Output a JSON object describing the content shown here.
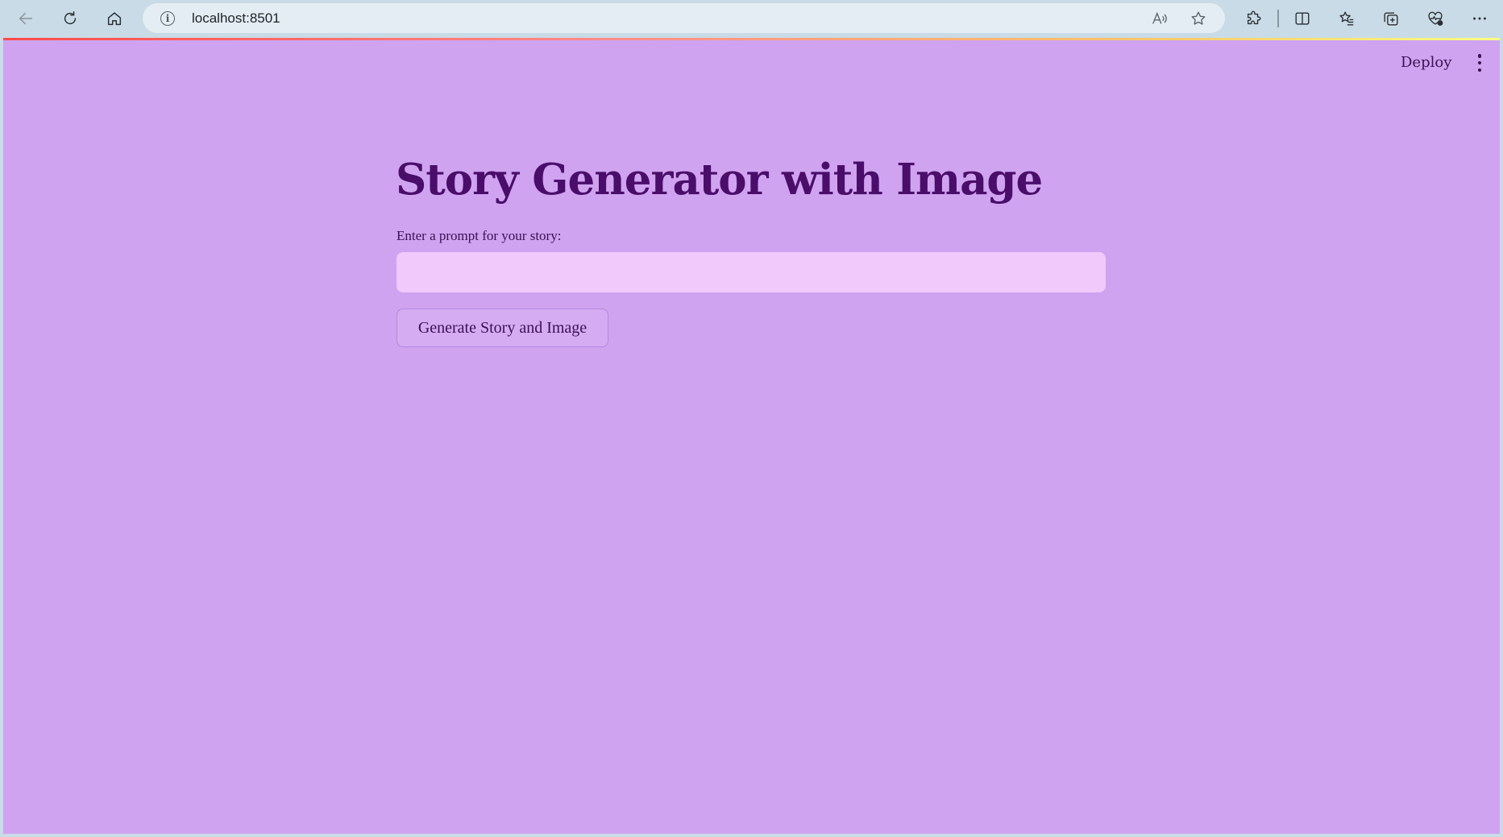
{
  "browser": {
    "url": "localhost:8501",
    "back_icon": "arrow-left-icon",
    "reload_icon": "refresh-icon",
    "home_icon": "home-icon",
    "info_icon": "info-icon",
    "read_aloud_icon": "read-aloud-icon",
    "favorite_icon": "star-icon",
    "extensions_icon": "puzzle-icon",
    "split_screen_icon": "split-screen-icon",
    "favorites_icon": "favorites-list-icon",
    "collections_icon": "collections-icon",
    "health_icon": "heart-pulse-icon",
    "menu_icon": "more-horizontal-icon"
  },
  "app": {
    "background": "#cfa3f0",
    "deploy_label": "Deploy",
    "title": "Story Generator with Image",
    "prompt_label": "Enter a prompt for your story:",
    "prompt_value": "",
    "generate_button_label": "Generate Story and Image",
    "title_color": "#4a0d6a",
    "input_bg": "#f2c9fb"
  }
}
